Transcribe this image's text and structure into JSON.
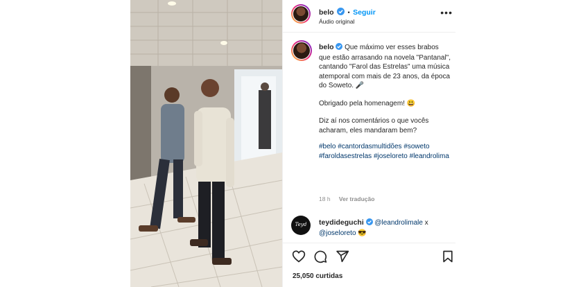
{
  "post": {
    "author": {
      "username": "belo",
      "follow_label": "Seguir",
      "separator": "•",
      "audio": "Áudio original",
      "more_label": "•••"
    },
    "caption": {
      "username": "belo",
      "text": "Que máximo ver esses brabos que estão arrasando na novela \"Pantanal\", cantando \"Farol das Estrelas\" uma música atemporal com mais de 23 anos, da  época do Soweto. 🎤",
      "thanks": "Obrigado pela homenagem! 😃",
      "question": "Diz aí nos comentários o que vocês acharam, eles mandaram bem?",
      "hashtags": [
        "#belo",
        "#cantordasmultidões",
        "#soweto",
        "#faroldasestrelas",
        "#joseloreto",
        "#leandrolima"
      ],
      "time": "18 h",
      "translate_label": "Ver tradução"
    },
    "comment": {
      "username": "teydideguchi",
      "avatar_text": "Teyd",
      "mention1": "@leandrolimale",
      "connector": "x",
      "mention2": "@joseloreto",
      "emoji": "😎"
    },
    "likes": "25,050 curtidas"
  },
  "colors": {
    "accent": "#0095f6",
    "link": "#00376b",
    "muted": "#8e8e8e",
    "verified": "#3897f0"
  },
  "icons": [
    "verified-icon",
    "heart-icon",
    "comment-icon",
    "share-icon",
    "bookmark-icon",
    "more-icon"
  ]
}
